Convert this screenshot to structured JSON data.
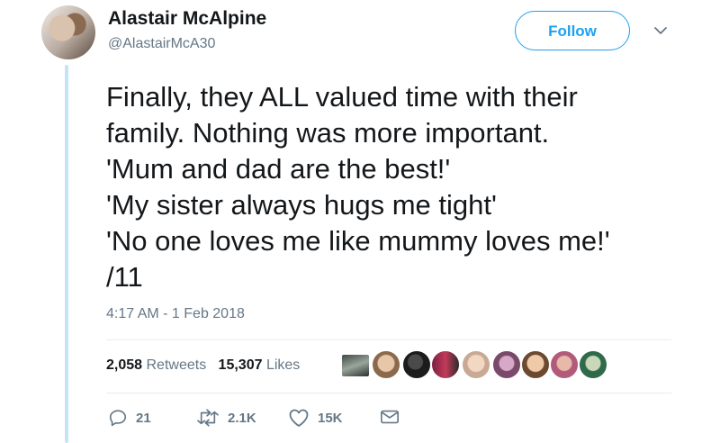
{
  "author": {
    "name": "Alastair McAlpine",
    "handle": "@AlastairMcA30",
    "avatar_icon": "profile-photo"
  },
  "follow_label": "Follow",
  "tweet": {
    "lines": [
      "Finally, they ALL valued time with their",
      "family. Nothing was more important.",
      "'Mum and dad are the best!'",
      "'My sister always hugs me tight'",
      "'No one loves me like mummy loves me!'",
      "/11"
    ],
    "timestamp": "4:17 AM - 1 Feb 2018"
  },
  "stats": {
    "retweets_count": "2,058",
    "retweets_label": "Retweets",
    "likes_count": "15,307",
    "likes_label": "Likes"
  },
  "actions": {
    "reply_count": "21",
    "retweet_count": "2.1K",
    "like_count": "15K"
  },
  "colors": {
    "accent": "#1da1f2",
    "secondary_text": "#657786",
    "thread_line": "#c4e4f7",
    "divider": "#e6ecf0"
  }
}
